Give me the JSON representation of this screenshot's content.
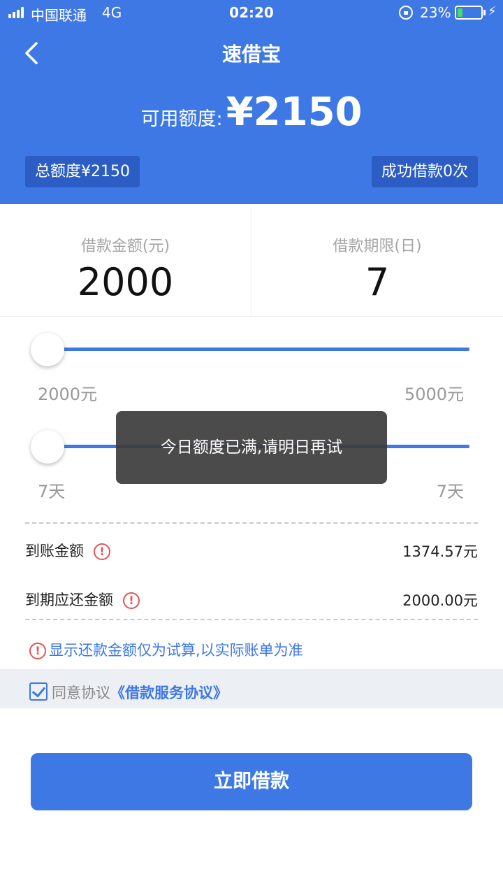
{
  "status_bar": {
    "carrier": "中国联通",
    "network": "4G",
    "time": "02:20",
    "battery_percent": "23%",
    "battery_level": 0.23,
    "battery_color": "#4cd964"
  },
  "header": {
    "title": "速借宝",
    "back_icon": "chevron-left-icon",
    "available_label": "可用额度:",
    "available_amount": "¥2150",
    "total_quota": "总额度¥2150",
    "success_count": "成功借款0次",
    "background_color": "#3e78e5"
  },
  "params": {
    "amount_label": "借款金额(元)",
    "amount_value": "2000",
    "term_label": "借款期限(日)",
    "term_value": "7"
  },
  "sliders": {
    "amount": {
      "min_label": "2000元",
      "max_label": "5000元",
      "value": 0.0
    },
    "term": {
      "min_label": "7天",
      "max_label": "7天",
      "value": 0.0
    }
  },
  "toast": {
    "message": "今日额度已满,请明日再试"
  },
  "summary": {
    "received_label": "到账金额",
    "received_value": "1374.57元",
    "due_label": "到期应还金额",
    "due_value": "2000.00元"
  },
  "note": "显示还款金额仅为试算,以实际账单为准",
  "agreement": {
    "checked": true,
    "label": "同意协议",
    "link": "《借款服务协议》"
  },
  "submit_button": "立即借款"
}
